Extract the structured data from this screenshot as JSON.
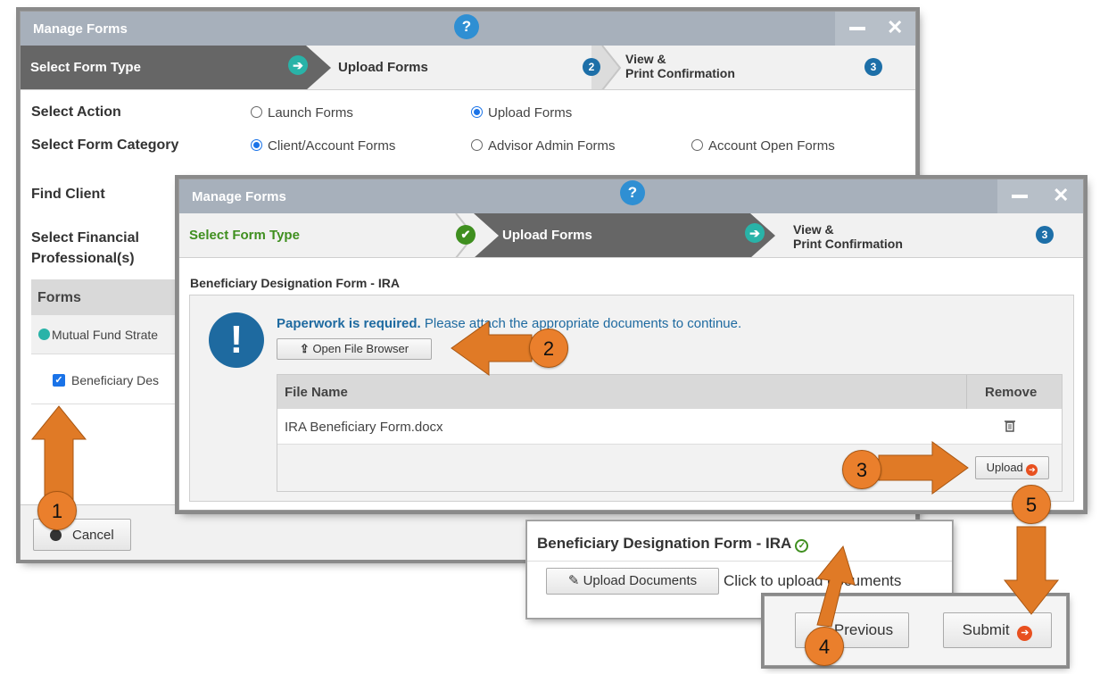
{
  "back_window": {
    "title": "Manage Forms",
    "help": "?",
    "steps": [
      {
        "label": "Select Form Type"
      },
      {
        "label": "Upload Forms",
        "num": "2"
      },
      {
        "label_line1": "View &",
        "label_line2": "Print Confirmation",
        "num": "3"
      }
    ],
    "select_action_label": "Select Action",
    "action_options": [
      "Launch Forms",
      "Upload Forms"
    ],
    "category_label": "Select Form Category",
    "category_options": [
      "Client/Account Forms",
      "Advisor Admin Forms",
      "Account Open Forms"
    ],
    "find_client_label": "Find Client",
    "financial_label_1": "Select Financial",
    "financial_label_2": "Professional(s)",
    "forms_header": "Forms",
    "group_item": "Mutual Fund Strate",
    "form_item": "Beneficiary Des",
    "cancel_label": "Cancel"
  },
  "front_window": {
    "title": "Manage Forms",
    "help": "?",
    "steps": [
      {
        "label": "Select Form Type"
      },
      {
        "label": "Upload Forms"
      },
      {
        "label_line1": "View &",
        "label_line2": "Print Confirmation",
        "num": "3"
      }
    ],
    "form_title": "Beneficiary Designation Form - IRA",
    "notice_bold": "Paperwork is required.",
    "notice_text": " Please attach the appropriate documents to continue.",
    "open_browser_label": "Open File Browser",
    "table": {
      "col_file": "File Name",
      "col_remove": "Remove",
      "rows": [
        {
          "file": "IRA Beneficiary Form.docx"
        }
      ]
    },
    "upload_label": "Upload"
  },
  "popup": {
    "title": "Beneficiary Designation Form - IRA",
    "upload_docs_label": "Upload Documents",
    "hint": "Click to upload documents"
  },
  "nav": {
    "previous_label": "Previous",
    "submit_label": "Submit"
  },
  "callouts": [
    "1",
    "2",
    "3",
    "4",
    "5"
  ],
  "colors": {
    "accent_orange": "#e07a26",
    "step_blue": "#1d6fa8",
    "green": "#3f8f1f",
    "help_blue": "#2f8fd3"
  }
}
